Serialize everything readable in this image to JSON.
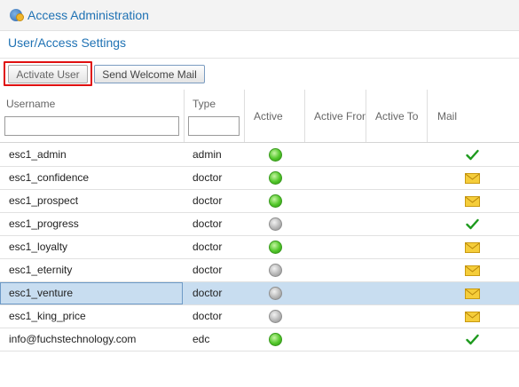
{
  "window": {
    "title": "Access Administration"
  },
  "section": {
    "title": "User/Access Settings"
  },
  "toolbar": {
    "activate_label": "Activate User",
    "welcome_label": "Send Welcome Mail"
  },
  "table": {
    "columns": {
      "username": "Username",
      "type": "Type",
      "active": "Active",
      "active_from": "Active From",
      "active_to": "Active To",
      "mail": "Mail"
    },
    "filters": {
      "username_value": "",
      "type_value": ""
    },
    "rows": [
      {
        "username": "esc1_admin",
        "type": "admin",
        "active": "green",
        "mail": "sent-check"
      },
      {
        "username": "esc1_confidence",
        "type": "doctor",
        "active": "green",
        "mail": "envelope"
      },
      {
        "username": "esc1_prospect",
        "type": "doctor",
        "active": "green",
        "mail": "envelope"
      },
      {
        "username": "esc1_progress",
        "type": "doctor",
        "active": "gray",
        "mail": "sent-check"
      },
      {
        "username": "esc1_loyalty",
        "type": "doctor",
        "active": "green",
        "mail": "envelope"
      },
      {
        "username": "esc1_eternity",
        "type": "doctor",
        "active": "gray",
        "mail": "envelope"
      },
      {
        "username": "esc1_venture",
        "type": "doctor",
        "active": "gray",
        "mail": "envelope",
        "selected": true
      },
      {
        "username": "esc1_king_price",
        "type": "doctor",
        "active": "gray",
        "mail": "envelope"
      },
      {
        "username": "info@fuchstechnology.com",
        "type": "edc",
        "active": "green",
        "mail": "sent-check"
      }
    ]
  },
  "colors": {
    "accent": "#1f72b4",
    "selection": "#c8ddf0",
    "highlight_border": "#e01010"
  }
}
